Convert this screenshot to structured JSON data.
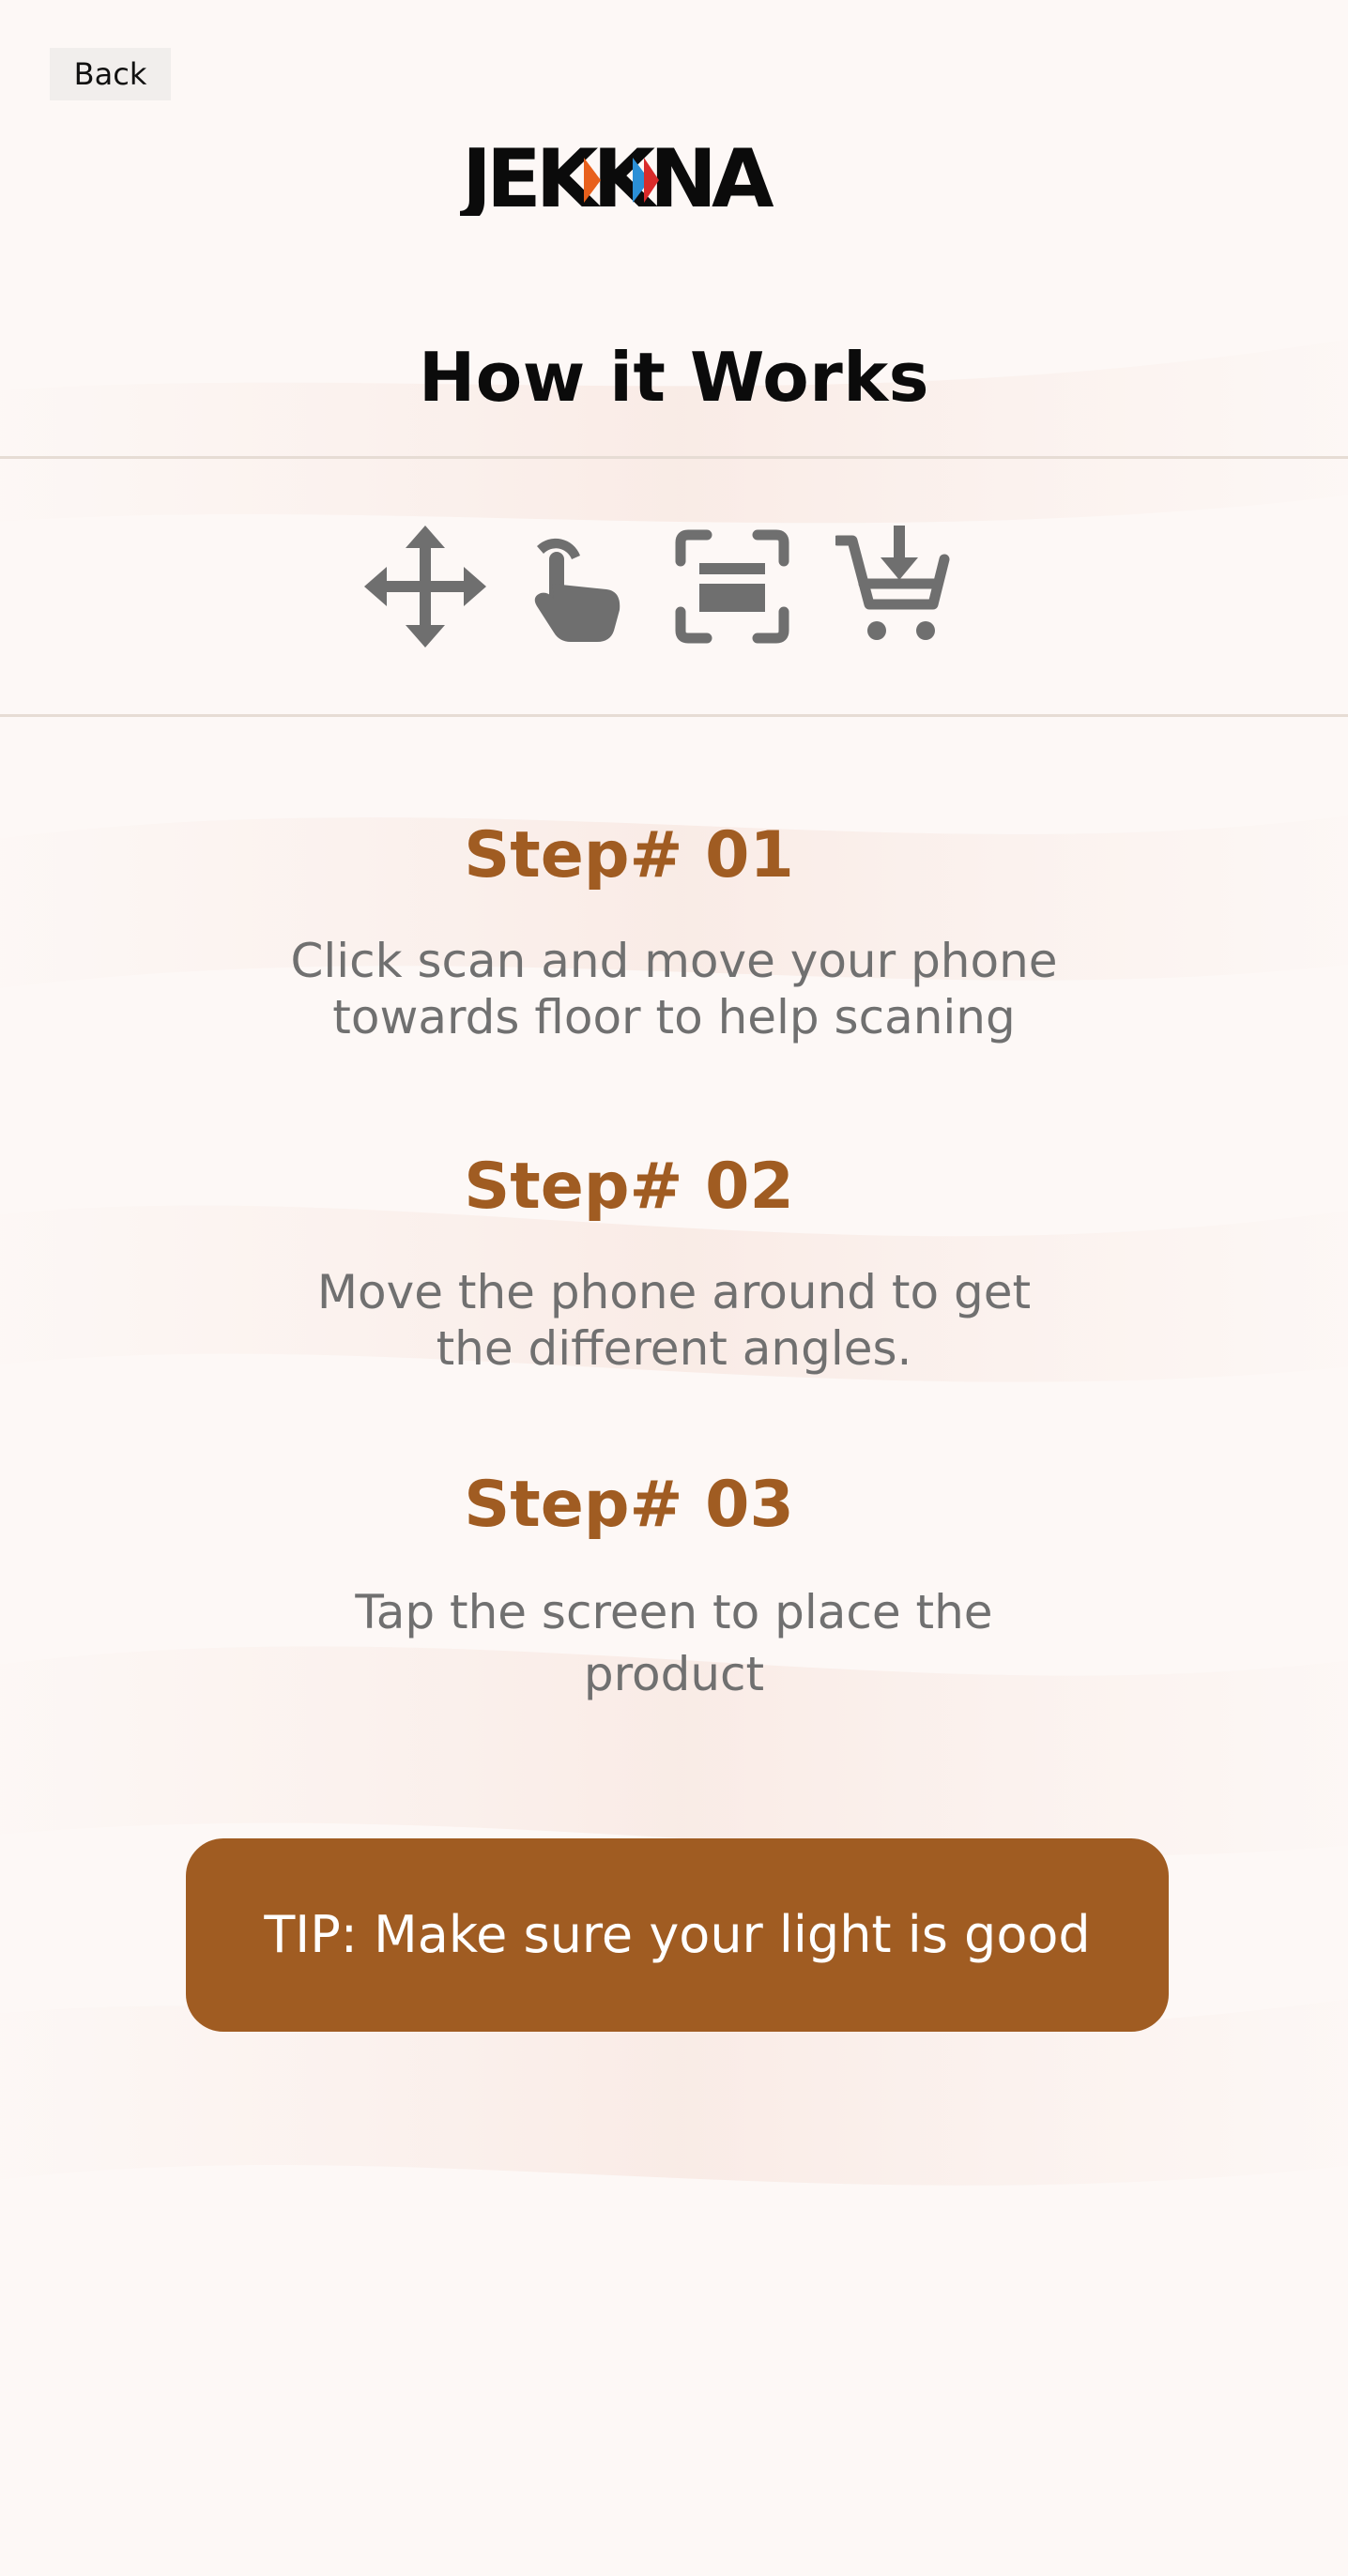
{
  "header": {
    "back_label": "Back",
    "logo_text": "JEKKNA"
  },
  "page_title": "How it Works",
  "icons": [
    "move-arrows-icon",
    "tap-hand-icon",
    "scan-frame-icon",
    "cart-download-icon"
  ],
  "steps": [
    {
      "title": "Step# 01",
      "desc_line1": "Click scan and move your phone",
      "desc_line2": "towards floor to help scaning"
    },
    {
      "title": "Step# 02",
      "desc_line1": "Move the phone around to get",
      "desc_line2": "the different angles."
    },
    {
      "title": "Step# 03",
      "desc_line1": "Tap the screen to place the",
      "desc_line2": "product"
    }
  ],
  "tip": "TIP: Make sure your light is good",
  "colors": {
    "accent": "#a05c22",
    "icon_gray": "#6f6f6f",
    "text_gray": "#707070",
    "title_black": "#0b0b0b",
    "background": "#fdf8f6"
  }
}
